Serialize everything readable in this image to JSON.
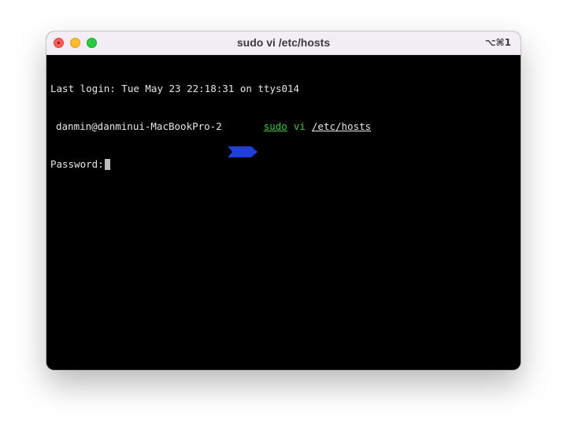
{
  "window": {
    "title": "sudo vi /etc/hosts",
    "shortcut": "⌥⌘1"
  },
  "terminal": {
    "last_login": "Last login: Tue May 23 22:18:31 on ttys014",
    "prompt_user": "danmin@danminui-MacBookPro-2",
    "command": {
      "sudo": "sudo",
      "vi": "vi",
      "path": "/etc/hosts"
    },
    "password_prompt": "Password:"
  },
  "colors": {
    "terminal_bg": "#000000",
    "titlebar_bg": "#f3edf5",
    "prompt_segment": "#1f3fd6",
    "command_green": "#3ecb3e",
    "text": "#e6e6e6"
  }
}
